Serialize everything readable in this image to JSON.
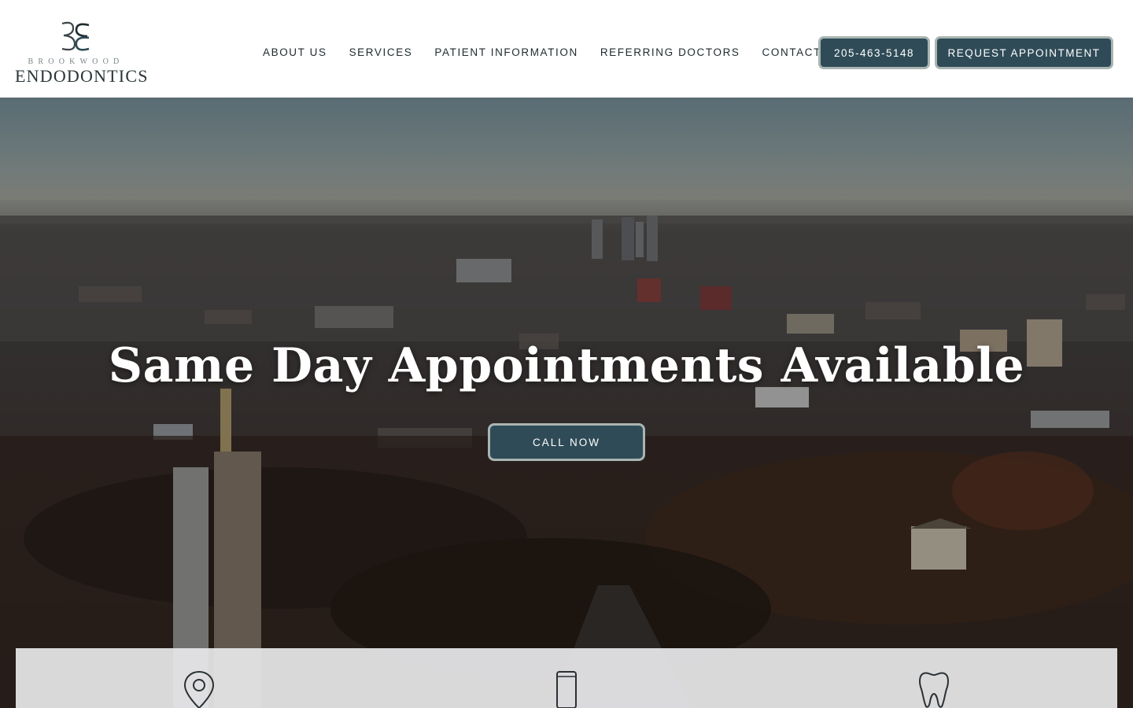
{
  "brand": {
    "name_small": "BROOKWOOD",
    "name_large": "ENDODONTICS",
    "logo_icon": "brookwood-monogram-logo"
  },
  "nav": {
    "items": [
      {
        "label": "ABOUT US"
      },
      {
        "label": "SERVICES"
      },
      {
        "label": "PATIENT INFORMATION"
      },
      {
        "label": "REFERRING DOCTORS"
      },
      {
        "label": "CONTACT"
      }
    ]
  },
  "header": {
    "phone_label": "205-463-5148",
    "request_label": "REQUEST APPOINTMENT"
  },
  "hero": {
    "title": "Same Day Appointments Available",
    "cta_label": "CALL NOW",
    "background": "aerial-city-skyline-photo"
  },
  "info_panel": {
    "icons": [
      "location-pin-icon",
      "mobile-phone-icon",
      "tooth-icon"
    ]
  },
  "colors": {
    "button_bg": "#2f4b57",
    "button_border": "#a9b5b2",
    "text_dark": "#1f2a2e",
    "white": "#ffffff"
  }
}
